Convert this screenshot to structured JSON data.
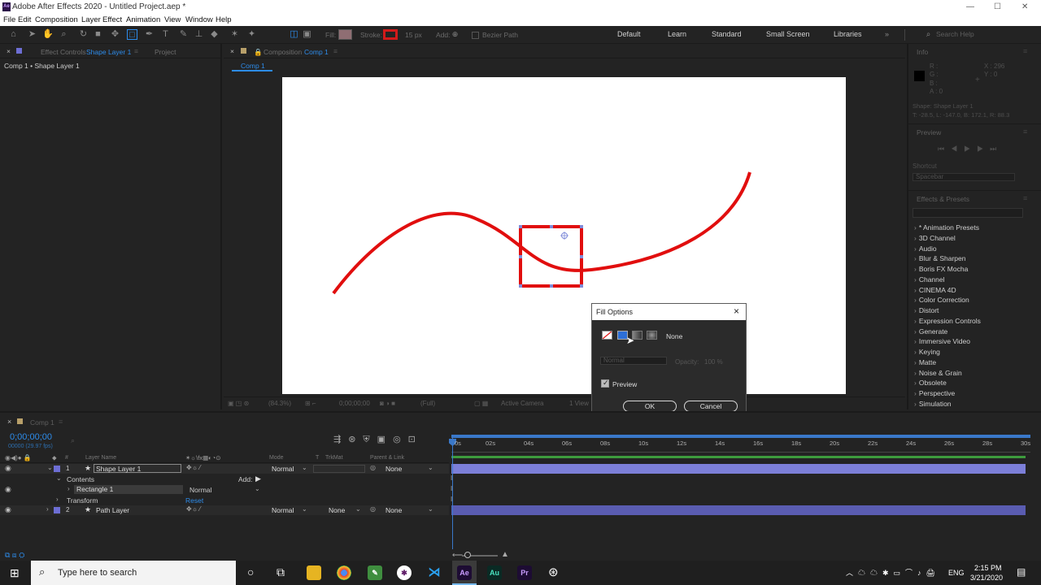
{
  "app": {
    "window_title": "Adobe After Effects 2020 - Untitled Project.aep *",
    "logo_text": "Ae",
    "menu": [
      "File",
      "Edit",
      "Composition",
      "Layer",
      "Effect",
      "Animation",
      "View",
      "Window",
      "Help"
    ]
  },
  "toolbar": {
    "fill_label": "Fill:",
    "stroke_label": "Stroke:",
    "stroke_width": "15 px",
    "add_label": "Add:",
    "bezier_label": "Bezier Path",
    "fill_color": "#8f6e73",
    "stroke_color": "#d11a1a",
    "workspaces": [
      "Default",
      "Learn",
      "Standard",
      "Small Screen",
      "Libraries"
    ],
    "overflow": "»",
    "search_placeholder": "Search Help"
  },
  "left_panel": {
    "tab_effect_controls_prefix": "Effect Controls",
    "tab_effect_controls_layer": "Shape Layer 1",
    "tab_project": "Project",
    "breadcrumb": "Comp 1 • Shape Layer 1"
  },
  "comp_panel": {
    "tab_prefix": "Composition",
    "tab_name": "Comp 1",
    "sub_tab": "Comp 1",
    "zoom": "(84.3%)",
    "timecode": "0;00;00;00",
    "resolution": "(Full)",
    "camera": "Active Camera",
    "views": "1 View"
  },
  "dialog": {
    "title": "Fill Options",
    "close": "×",
    "fill_type_label": "None",
    "blend_mode": "Normal",
    "opacity_label": "Opacity:",
    "opacity_value": "100 %",
    "preview_label": "Preview",
    "preview_checked": true,
    "ok": "OK",
    "cancel": "Cancel"
  },
  "info_panel": {
    "title": "Info",
    "r": "R :",
    "g": "G :",
    "b": "B :",
    "a": "A :  0",
    "x": "X : 296",
    "y": "Y : 0",
    "shape_line1": "Shape: Shape Layer 1",
    "shape_line2": "T: -28.5, L: -147.0, B: 172.1, R: 88.3"
  },
  "preview_panel": {
    "title": "Preview",
    "shortcut_label": "Shortcut",
    "shortcut_value": "Spacebar"
  },
  "effects_panel": {
    "title": "Effects & Presets",
    "items": [
      "* Animation Presets",
      "3D Channel",
      "Audio",
      "Blur & Sharpen",
      "Boris FX Mocha",
      "Channel",
      "CINEMA 4D",
      "Color Correction",
      "Distort",
      "Expression Controls",
      "Generate",
      "Immersive Video",
      "Keying",
      "Matte",
      "Noise & Grain",
      "Obsolete",
      "Perspective",
      "Simulation"
    ]
  },
  "timeline": {
    "tab": "Comp 1",
    "timecode": "0;00;00;00",
    "fps": "00000 (29.97 fps)",
    "headers": {
      "num": "#",
      "layer_name": "Layer Name",
      "mode": "Mode",
      "t": "T",
      "trkmat": "TrkMat",
      "parent": "Parent & Link"
    },
    "layers": [
      {
        "num": "1",
        "name": "Shape Layer 1",
        "mode": "Normal",
        "parent": "None",
        "color": "#6d6ed4"
      },
      {
        "num": "2",
        "name": "Path Layer",
        "mode": "Normal",
        "trkmat": "None",
        "parent": "None",
        "color": "#6d6ed4"
      }
    ],
    "contents_label": "Contents",
    "add_label": "Add:",
    "rectangle_label": "Rectangle 1",
    "rectangle_mode": "Normal",
    "transform_label": "Transform",
    "reset_label": "Reset",
    "ruler": [
      "0s",
      "02s",
      "04s",
      "06s",
      "08s",
      "10s",
      "12s",
      "14s",
      "16s",
      "18s",
      "20s",
      "22s",
      "24s",
      "26s",
      "28s",
      "30s"
    ]
  },
  "taskbar": {
    "search_placeholder": "Type here to search",
    "language": "ENG",
    "time": "2:15 PM",
    "date": "3/21/2020",
    "apps": [
      {
        "name": "Ae",
        "bg": "#1d0c33",
        "fg": "#c99cff"
      },
      {
        "name": "Au",
        "bg": "#0a2a24",
        "fg": "#49e3c0"
      },
      {
        "name": "Pr",
        "bg": "#1d0c33",
        "fg": "#c99cff"
      }
    ]
  }
}
